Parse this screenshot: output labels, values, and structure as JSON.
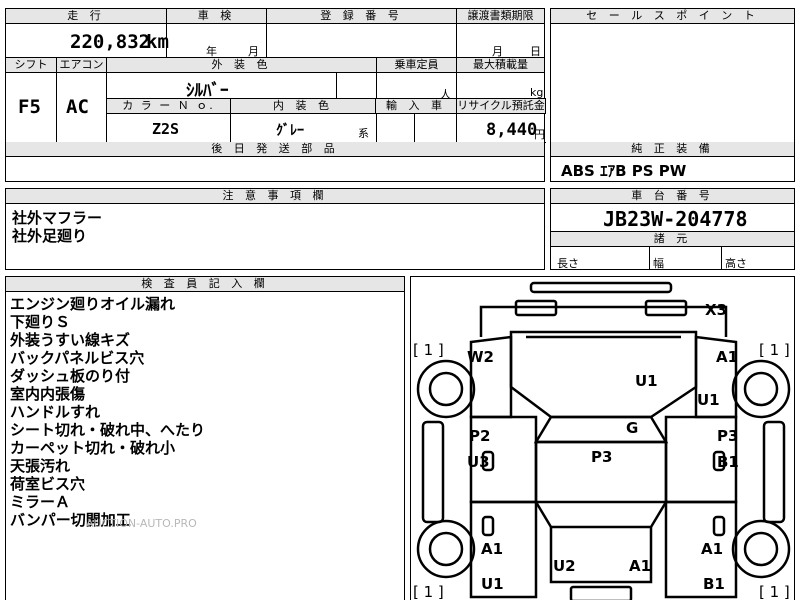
{
  "top": {
    "mileage_label": "走 行",
    "mileage_value": "220,832",
    "mileage_unit": "km",
    "shaken_label": "車 検",
    "shaken_year": "年",
    "shaken_month": "月",
    "reg_label": "登 録 番 号",
    "transfer_label": "譲渡書類期限",
    "transfer_month": "月",
    "transfer_day": "日",
    "sales_label": "セ ー ル ス ポ イ ン ト"
  },
  "spec": {
    "shift_label": "シフト",
    "shift_value": "F5",
    "ac_label": "エアコン",
    "ac_value": "AC",
    "exterior_label": "外 装 色",
    "exterior_value": "ｼﾙﾊﾞｰ",
    "capacity_label": "乗車定員",
    "capacity_unit": "人",
    "load_label": "最大積載量",
    "load_unit": "kg",
    "color_no_label": "カ ラ ー Ｎ ｏ.",
    "color_no_value": "Z2S",
    "interior_label": "内 装 色",
    "interior_value": "ｸﾞﾚｰ",
    "interior_suffix": "系",
    "import_label": "輸 入 車",
    "recycle_label": "リサイクル預託金",
    "recycle_value": "8,440",
    "recycle_unit": "円",
    "parts_label": "後 日 発 送 部 品",
    "equipment_label": "純 正 装 備",
    "equipment_value": "ABS ｴｱB PS PW"
  },
  "notes": {
    "label": "注 意 事 項 欄",
    "lines": [
      "社外マフラー",
      "社外足廻り"
    ]
  },
  "chassis": {
    "label": "車 台 番 号",
    "value": "JB23W-204778",
    "dims_label": "諸 元",
    "length_label": "長さ",
    "width_label": "幅",
    "height_label": "高さ"
  },
  "inspector": {
    "label": "検 査 員 記 入 欄",
    "lines": [
      "エンジン廻りオイル漏れ",
      "下廻りＳ",
      "外装うすい線キズ",
      "バックパネルビス穴",
      "ダッシュ板のり付",
      "室内内張傷",
      "ハンドルすれ",
      "シート切れ・破れ中、へたり",
      "カーペット切れ・破れ小",
      "天張汚れ",
      "荷室ビス穴",
      "ミラーＡ",
      "バンパー切開加工"
    ]
  },
  "diagram": {
    "marks": {
      "x3": "X3",
      "w2": "W2",
      "a1_fr": "A1",
      "u1_hood": "U1",
      "u1_fr_fender": "U1",
      "p2": "P2",
      "u3": "U3",
      "g": "G",
      "p3_center": "P3",
      "p3_right": "P3",
      "b1_right": "B1",
      "a1_rl": "A1",
      "a1_rr": "A1",
      "u1_rl": "U1",
      "u2": "U2",
      "a1_rear": "A1",
      "b1_rr": "B1"
    },
    "bracket_tl": "[ 1 ]",
    "bracket_tr": "[ 1 ]",
    "bracket_bl": "[ 1 ]",
    "bracket_br": "[ 1 ]"
  },
  "watermark": "AUCTION-AUTO.PRO"
}
